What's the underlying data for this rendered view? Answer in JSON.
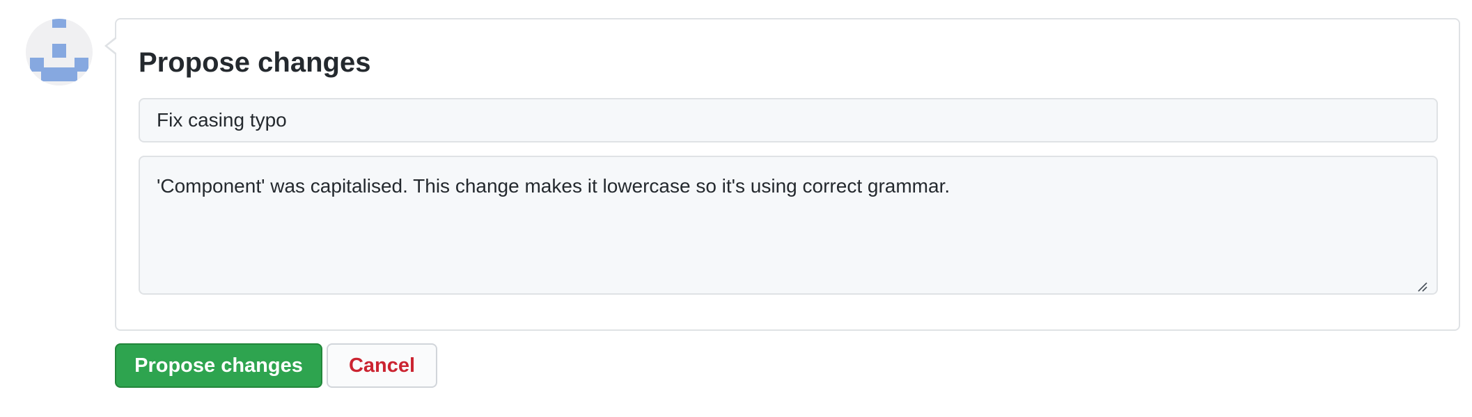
{
  "form": {
    "title": "Propose changes",
    "summary_value": "Fix casing typo",
    "description_value": "'Component' was capitalised. This change makes it lowercase so it's using correct grammar."
  },
  "actions": {
    "submit_label": "Propose changes",
    "cancel_label": "Cancel"
  },
  "colors": {
    "primary_button": "#2ea44f",
    "cancel_text": "#cb2431",
    "avatar_identicon": "#86a8e0"
  },
  "icons": {
    "avatar": "identicon-avatar",
    "resize": "textarea-resize-grip-icon"
  }
}
